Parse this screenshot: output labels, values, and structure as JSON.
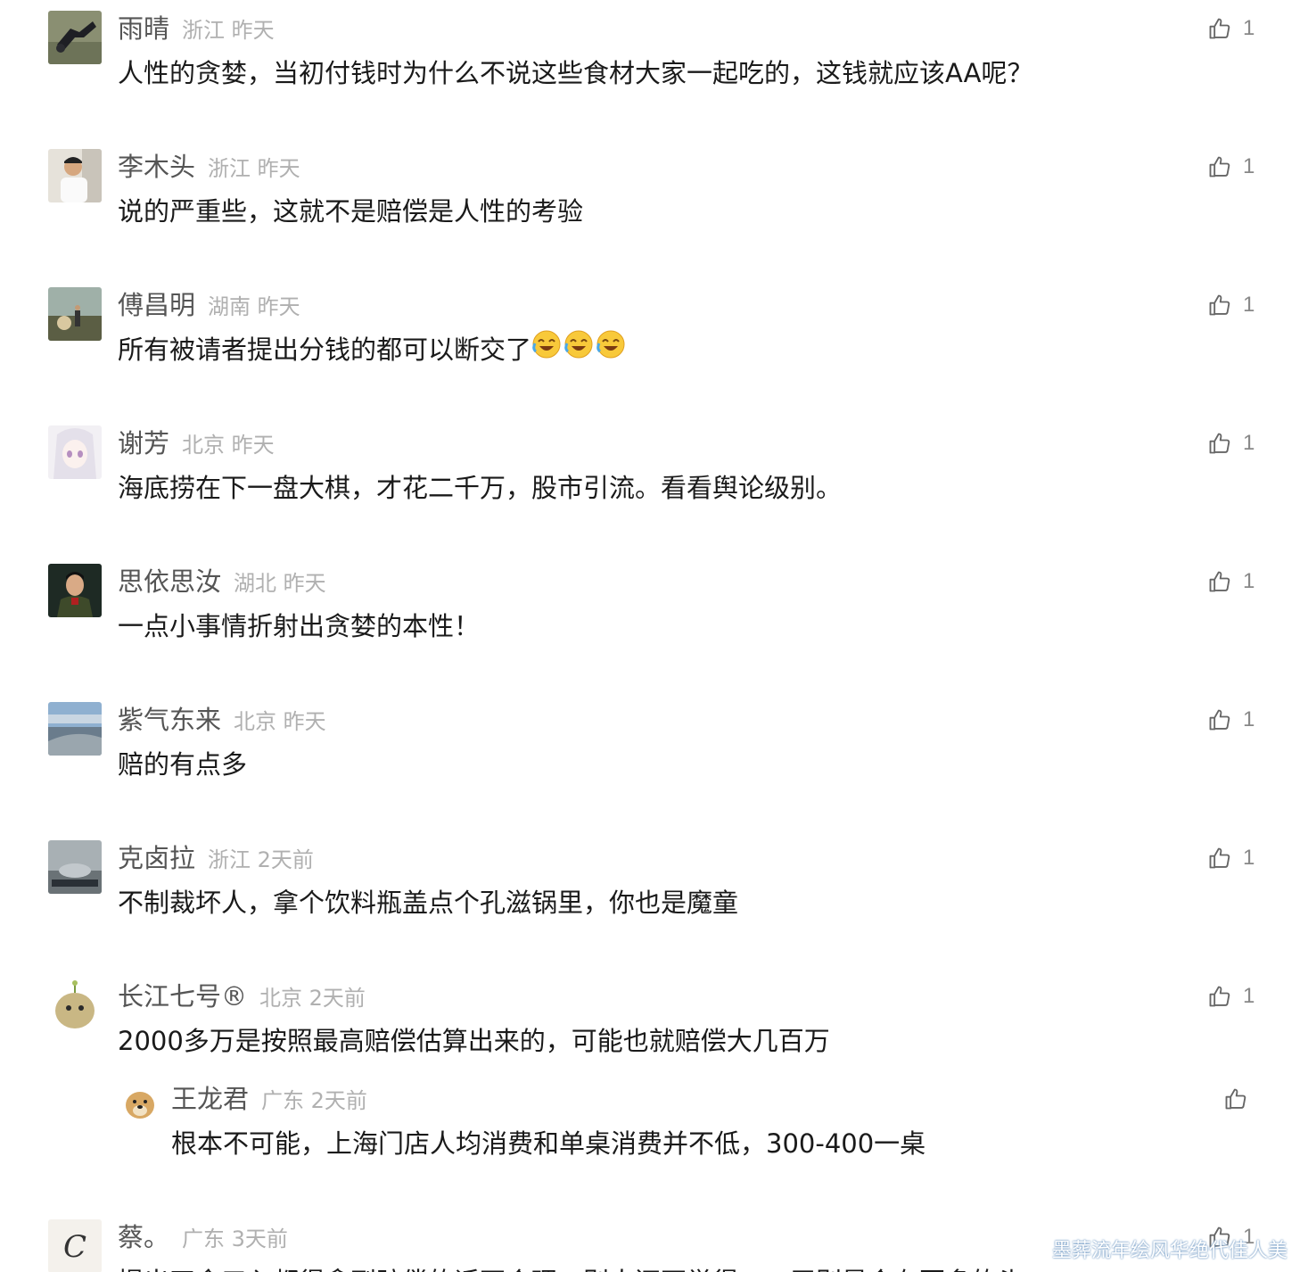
{
  "comments": [
    {
      "name": "雨晴",
      "location": "浙江",
      "time": "昨天",
      "content": "人性的贪婪，当初付钱时为什么不说这些食材大家一起吃的，这钱就应该AA呢？",
      "likes": "1"
    },
    {
      "name": "李木头",
      "location": "浙江",
      "time": "昨天",
      "content": "说的严重些，这就不是赔偿是人性的考验",
      "likes": "1"
    },
    {
      "name": "傅昌明",
      "location": "湖南",
      "time": "昨天",
      "content": "所有被请者提出分钱的都可以断交了",
      "likes": "1"
    },
    {
      "name": "谢芳",
      "location": "北京",
      "time": "昨天",
      "content": "海底捞在下一盘大棋，才花二千万，股市引流。看看舆论级别。",
      "likes": "1"
    },
    {
      "name": "思依思汝",
      "location": "湖北",
      "time": "昨天",
      "content": "一点小事情折射出贪婪的本性！",
      "likes": "1"
    },
    {
      "name": "紫气东来",
      "location": "北京",
      "time": "昨天",
      "content": "赔的有点多",
      "likes": "1"
    },
    {
      "name": "克卤拉",
      "location": "浙江",
      "time": "2天前",
      "content": "不制裁坏人，拿个饮料瓶盖点个孔滋锅里，你也是魔童",
      "likes": "1"
    },
    {
      "name": "长江七号®",
      "location": "北京",
      "time": "2天前",
      "content": "2000多万是按照最高赔偿估算出来的，可能也就赔偿大几百万",
      "likes": "1"
    },
    {
      "name": "蔡。",
      "location": "广东",
      "time": "3天前",
      "content": "提出四舍五入都得拿到赔偿的话不合理，别人还不觉得……无别是会有更多的头",
      "likes": "1"
    }
  ],
  "reply": {
    "name": "王龙君",
    "location": "广东",
    "time": "2天前",
    "content": "根本不可能，上海门店人均消费和单桌消费并不低，300-400一桌"
  },
  "watermark": "墨葬流年绘风华绝代佳人美",
  "colors": {
    "name": "#555555",
    "meta": "#b0b0b0",
    "content": "#1a1a1a",
    "like": "#888888"
  }
}
